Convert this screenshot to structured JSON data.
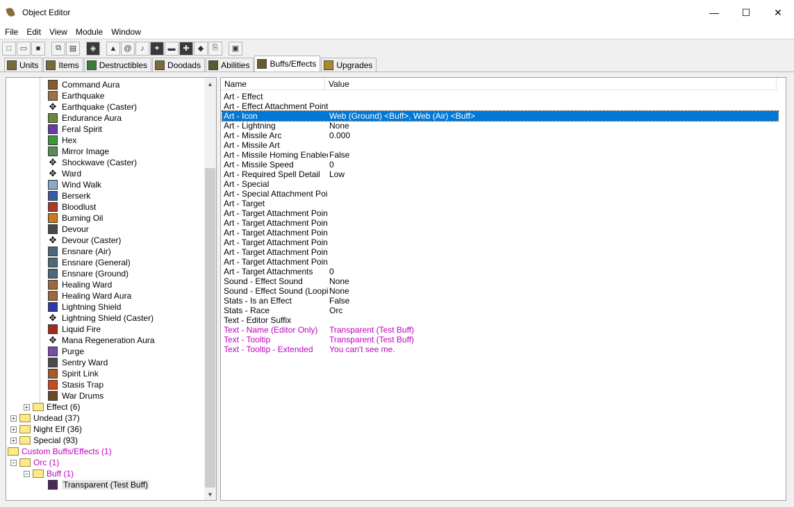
{
  "window": {
    "title": "Object Editor",
    "minimize": "—",
    "maximize": "☐",
    "close": "✕"
  },
  "menu": [
    "File",
    "Edit",
    "View",
    "Module",
    "Window"
  ],
  "toolbar_icons": [
    "new-icon",
    "open-icon",
    "save-icon",
    "copy-icon",
    "paste-icon",
    "unit-icon",
    "terrain-icon",
    "doodad-icon",
    "sound-icon",
    "footprint-icon",
    "monitor-icon",
    "trigger-icon",
    "object-icon",
    "import-icon",
    "test-map-icon"
  ],
  "tabs": [
    {
      "label": "Units",
      "active": false
    },
    {
      "label": "Items",
      "active": false
    },
    {
      "label": "Destructibles",
      "active": false
    },
    {
      "label": "Doodads",
      "active": false
    },
    {
      "label": "Abilities",
      "active": false
    },
    {
      "label": "Buffs/Effects",
      "active": true
    },
    {
      "label": "Upgrades",
      "active": false
    }
  ],
  "tree": {
    "items": [
      {
        "label": "Command Aura",
        "type": "buff",
        "color": "#8a5a2a"
      },
      {
        "label": "Earthquake",
        "type": "buff",
        "color": "#a07040"
      },
      {
        "label": "Earthquake (Caster)",
        "type": "caster",
        "color": "#000000"
      },
      {
        "label": "Endurance Aura",
        "type": "buff",
        "color": "#6a8a3a"
      },
      {
        "label": "Feral Spirit",
        "type": "buff",
        "color": "#6a3aaa"
      },
      {
        "label": "Hex",
        "type": "buff",
        "color": "#3a9a3a"
      },
      {
        "label": "Mirror Image",
        "type": "buff",
        "color": "#5a8a5a"
      },
      {
        "label": "Shockwave (Caster)",
        "type": "caster",
        "color": "#000000"
      },
      {
        "label": "Ward",
        "type": "caster",
        "color": "#000000"
      },
      {
        "label": "Wind Walk",
        "type": "buff",
        "color": "#8aaacc"
      },
      {
        "label": "Berserk",
        "type": "buff",
        "color": "#3a5aaa"
      },
      {
        "label": "Bloodlust",
        "type": "buff",
        "color": "#aa3a2a"
      },
      {
        "label": "Burning Oil",
        "type": "buff",
        "color": "#cc7a1a"
      },
      {
        "label": "Devour",
        "type": "buff",
        "color": "#4a4a4a"
      },
      {
        "label": "Devour (Caster)",
        "type": "caster",
        "color": "#000000"
      },
      {
        "label": "Ensnare (Air)",
        "type": "buff",
        "color": "#4a6a7a"
      },
      {
        "label": "Ensnare (General)",
        "type": "buff",
        "color": "#4a6a7a"
      },
      {
        "label": "Ensnare (Ground)",
        "type": "buff",
        "color": "#4a6a7a"
      },
      {
        "label": "Healing Ward",
        "type": "buff",
        "color": "#9a6a3a"
      },
      {
        "label": "Healing Ward Aura",
        "type": "buff",
        "color": "#9a6a3a"
      },
      {
        "label": "Lightning Shield",
        "type": "buff",
        "color": "#2a3aaa"
      },
      {
        "label": "Lightning Shield (Caster)",
        "type": "caster",
        "color": "#000000"
      },
      {
        "label": "Liquid Fire",
        "type": "buff",
        "color": "#aa2a1a"
      },
      {
        "label": "Mana Regeneration Aura",
        "type": "caster",
        "color": "#000000"
      },
      {
        "label": "Purge",
        "type": "buff",
        "color": "#7a4aaa"
      },
      {
        "label": "Sentry Ward",
        "type": "buff",
        "color": "#4a4a4a"
      },
      {
        "label": "Spirit Link",
        "type": "buff",
        "color": "#aa5a2a"
      },
      {
        "label": "Stasis Trap",
        "type": "buff",
        "color": "#cc4a1a"
      },
      {
        "label": "War Drums",
        "type": "buff",
        "color": "#6a4a2a"
      }
    ],
    "effect_folder": "Effect (6)",
    "folders": [
      "Undead (37)",
      "Night Elf (36)",
      "Special (93)"
    ],
    "custom_root": "Custom Buffs/Effects (1)",
    "custom_orc": "Orc (1)",
    "custom_buff": "Buff (1)",
    "custom_item": "Transparent (Test Buff)"
  },
  "table": {
    "headers": {
      "name": "Name",
      "value": "Value"
    },
    "rows": [
      {
        "name": "Art - Effect",
        "value": ""
      },
      {
        "name": "Art - Effect Attachment Point",
        "value": ""
      },
      {
        "name": "Art - Icon",
        "value": "Web (Ground) <Buff>, Web (Air) <Buff>",
        "selected": true
      },
      {
        "name": "Art - Lightning",
        "value": "None"
      },
      {
        "name": "Art - Missile Arc",
        "value": "0.000"
      },
      {
        "name": "Art - Missile Art",
        "value": ""
      },
      {
        "name": "Art - Missile Homing Enabled",
        "value": "False"
      },
      {
        "name": "Art - Missile Speed",
        "value": "0"
      },
      {
        "name": "Art - Required Spell Detail",
        "value": "Low"
      },
      {
        "name": "Art - Special",
        "value": ""
      },
      {
        "name": "Art - Special Attachment Point",
        "value": ""
      },
      {
        "name": "Art - Target",
        "value": ""
      },
      {
        "name": "Art - Target Attachment Poin...",
        "value": ""
      },
      {
        "name": "Art - Target Attachment Poin...",
        "value": ""
      },
      {
        "name": "Art - Target Attachment Poin...",
        "value": ""
      },
      {
        "name": "Art - Target Attachment Poin...",
        "value": ""
      },
      {
        "name": "Art - Target Attachment Poin...",
        "value": ""
      },
      {
        "name": "Art - Target Attachment Poin...",
        "value": ""
      },
      {
        "name": "Art - Target Attachments",
        "value": "0"
      },
      {
        "name": "Sound - Effect Sound",
        "value": "None"
      },
      {
        "name": "Sound - Effect Sound (Loopi...",
        "value": "None"
      },
      {
        "name": "Stats - Is an Effect",
        "value": "False"
      },
      {
        "name": "Stats - Race",
        "value": "Orc"
      },
      {
        "name": "Text - Editor Suffix",
        "value": ""
      },
      {
        "name": "Text - Name (Editor Only)",
        "value": "Transparent (Test Buff)",
        "custom": true
      },
      {
        "name": "Text - Tooltip",
        "value": "Transparent (Test Buff)",
        "custom": true
      },
      {
        "name": "Text - Tooltip - Extended",
        "value": "You can't see me.",
        "custom": true
      }
    ]
  }
}
